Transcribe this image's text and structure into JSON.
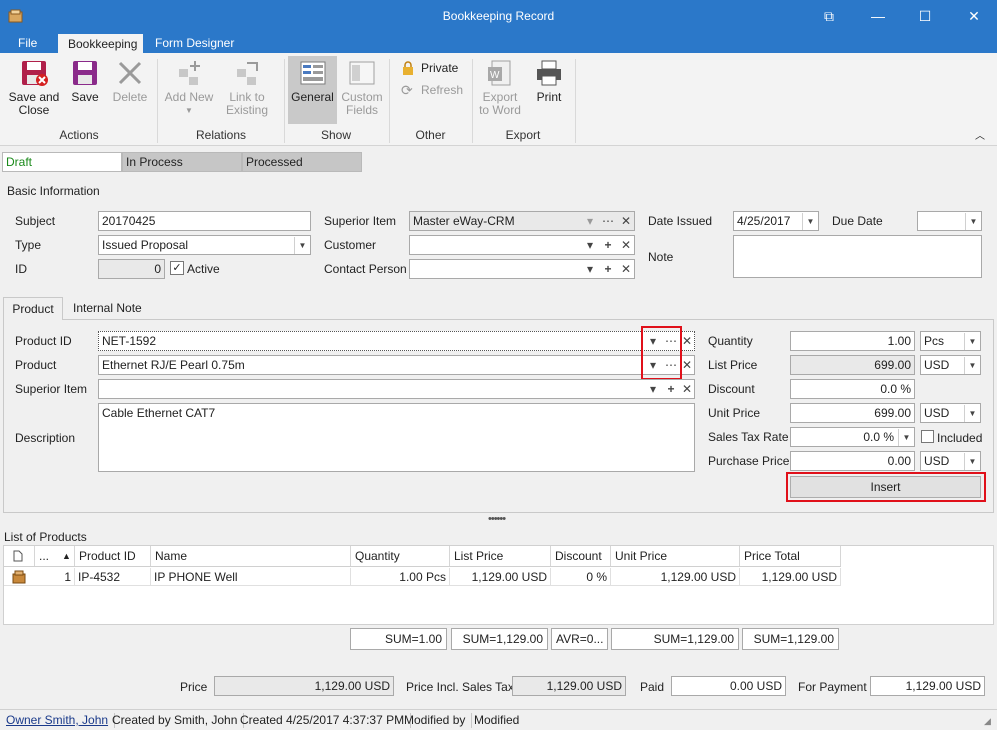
{
  "window": {
    "title": "Bookkeeping Record"
  },
  "ribbon": {
    "tabs": [
      "File",
      "Bookkeeping",
      "Form Designer"
    ],
    "buttons": {
      "save_close_1": "Save and",
      "save_close_2": "Close",
      "save": "Save",
      "delete": "Delete",
      "add_new": "Add New",
      "link_1": "Link to",
      "link_2": "Existing",
      "general": "General",
      "custom_1": "Custom",
      "custom_2": "Fields",
      "private": "Private",
      "refresh": "Refresh",
      "export_1": "Export",
      "export_2": "to Word",
      "print": "Print"
    },
    "groups": [
      "Actions",
      "Relations",
      "Show",
      "Other",
      "Export"
    ]
  },
  "status_tabs": [
    "Draft",
    "In Process",
    "Processed"
  ],
  "colors": {
    "accent": "#2b78c9",
    "draft_text": "#1a8a1a",
    "highlight_box": "#e0101a"
  },
  "basic": {
    "section": "Basic Information",
    "subject_label": "Subject",
    "subject": "20170425",
    "type_label": "Type",
    "type": "Issued Proposal",
    "id_label": "ID",
    "id": "0",
    "active": "Active",
    "superior_label": "Superior Item",
    "superior": "Master eWay-CRM",
    "customer_label": "Customer",
    "customer": "",
    "contact_label": "Contact Person",
    "contact": "",
    "date_issued_label": "Date Issued",
    "date_issued": "4/25/2017",
    "due_date_label": "Due Date",
    "due_date": "",
    "note_label": "Note",
    "note": ""
  },
  "product_tabs": [
    "Product",
    "Internal Note"
  ],
  "product": {
    "product_id_label": "Product ID",
    "product_id": "NET-1592",
    "product_label": "Product",
    "product": "Ethernet RJ/E Pearl 0.75m",
    "superior_label": "Superior Item",
    "superior": "",
    "description_label": "Description",
    "description": "Cable Ethernet CAT7",
    "quantity_label": "Quantity",
    "quantity": "1.00",
    "quantity_unit": "Pcs",
    "list_price_label": "List Price",
    "list_price": "699.00",
    "list_price_cur": "USD",
    "discount_label": "Discount",
    "discount": "0.0 %",
    "unit_price_label": "Unit Price",
    "unit_price": "699.00",
    "unit_price_cur": "USD",
    "tax_label": "Sales Tax Rate",
    "tax": "0.0 %",
    "included": "Included",
    "purchase_label": "Purchase Price",
    "purchase": "0.00",
    "purchase_cur": "USD",
    "insert": "Insert"
  },
  "list": {
    "title": "List of Products",
    "headers": [
      "...",
      "Product ID",
      "Name",
      "Quantity",
      "List Price",
      "Discount",
      "Unit Price",
      "Price Total"
    ],
    "rows": [
      {
        "num": "1",
        "pid": "IP-4532",
        "name": "IP PHONE Well",
        "qty": "1.00 Pcs",
        "list": "1,129.00 USD",
        "disc": "0 %",
        "unit": "1,129.00 USD",
        "total": "1,129.00 USD"
      }
    ],
    "sums": [
      "SUM=1.00",
      "SUM=1,129.00",
      "AVR=0...",
      "SUM=1,129.00",
      "SUM=1,129.00"
    ]
  },
  "totals": {
    "price_label": "Price",
    "price": "1,129.00 USD",
    "price_tax_label": "Price Incl. Sales Tax",
    "price_tax": "1,129.00 USD",
    "paid_label": "Paid",
    "paid": "0.00 USD",
    "for_payment_label": "For Payment",
    "for_payment": "1,129.00 USD"
  },
  "footer": {
    "owner": "Owner Smith, John",
    "created_by": "Created by Smith, John",
    "created": "Created 4/25/2017 4:37:37 PM",
    "modified_by": "Modified by",
    "modified": "Modified"
  }
}
